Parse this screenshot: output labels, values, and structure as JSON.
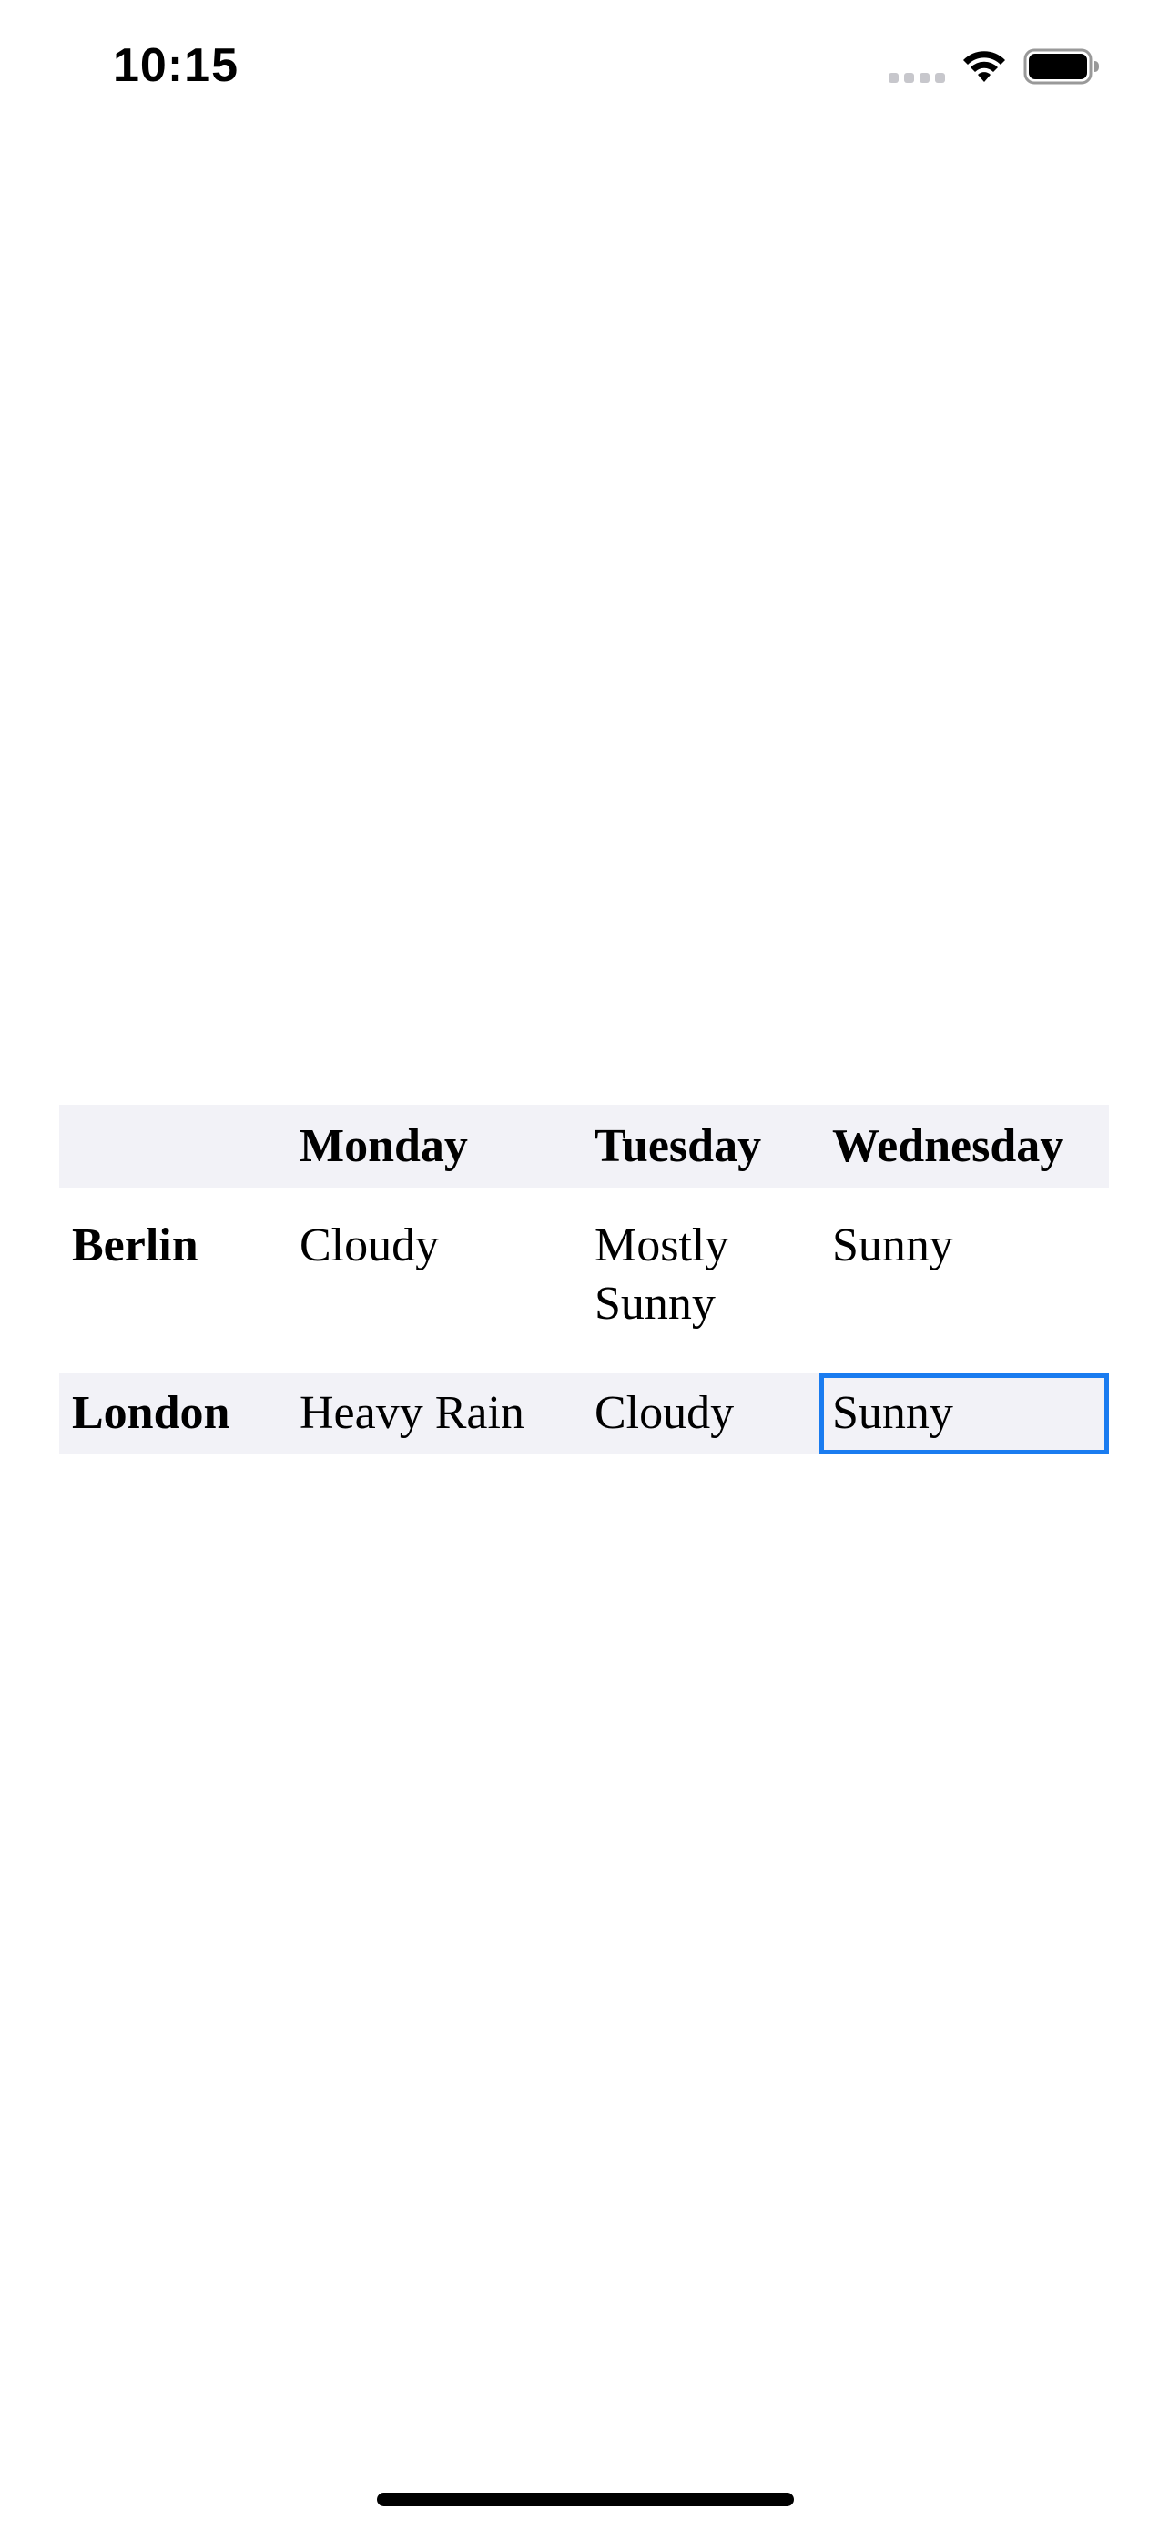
{
  "status_bar": {
    "time": "10:15",
    "icons": [
      "cellular-signal-icon",
      "wifi-icon",
      "battery-icon"
    ]
  },
  "table": {
    "columns": [
      "",
      "Monday",
      "Tuesday",
      "Wednesday"
    ],
    "rows": [
      {
        "city": "Berlin",
        "cells": [
          "Cloudy",
          "Mostly Sunny",
          "Sunny"
        ]
      },
      {
        "city": "London",
        "cells": [
          "Heavy Rain",
          "Cloudy",
          "Sunny"
        ]
      }
    ],
    "selected_cell": "London / Wednesday"
  },
  "colors": {
    "band_background": "#f2f2f7",
    "selection_outline": "#1a7cf0",
    "text": "#000000"
  }
}
